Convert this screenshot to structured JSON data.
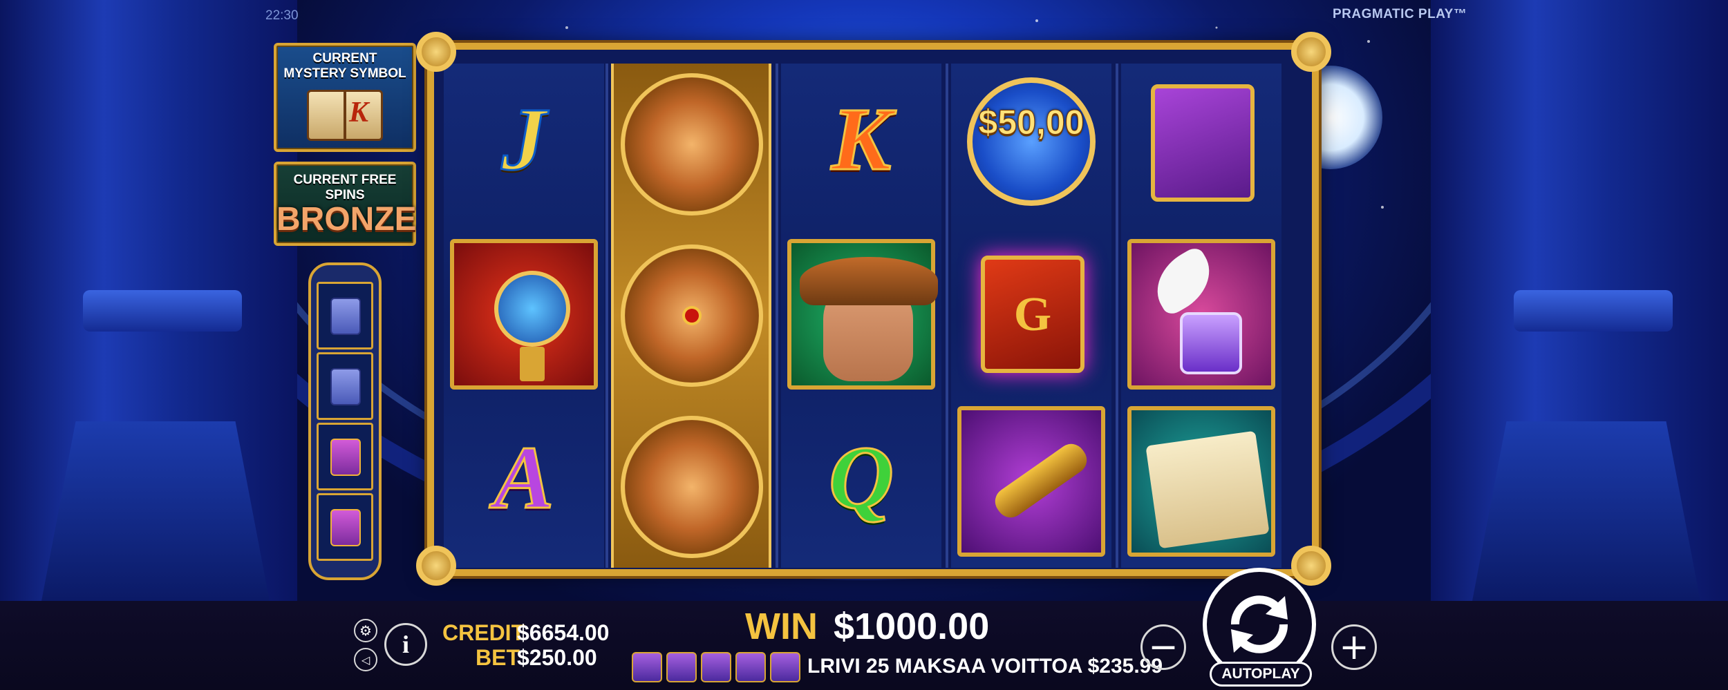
{
  "header": {
    "clock": "22:30",
    "brand": "PRAGMATIC PLAY™"
  },
  "side_panels": {
    "mystery": {
      "title_line1": "CURRENT",
      "title_line2": "MYSTERY SYMBOL",
      "symbol_letter": "K",
      "icon": "book-icon"
    },
    "free_spins": {
      "title": "CURRENT FREE SPINS",
      "level": "BRONZE"
    },
    "progress": {
      "collected": 2,
      "total": 4,
      "icon": "chest-icon"
    }
  },
  "reels": [
    {
      "symbols": [
        "J",
        "armillary-sphere",
        "A"
      ]
    },
    {
      "symbols": [
        "compass",
        "compass-rose",
        "compass"
      ]
    },
    {
      "symbols": [
        "K",
        "explorer",
        "Q"
      ]
    },
    {
      "symbols": [
        "$50,00",
        "book-of-mystery",
        "telescope"
      ]
    },
    {
      "symbols": [
        "treasure-book",
        "quill-and-ink",
        "map-scroll"
      ]
    }
  ],
  "money_symbol": {
    "value": "$50,00"
  },
  "bottom_bar": {
    "credit_label": "CREDIT",
    "credit_value": "$6654.00",
    "bet_label": "BET",
    "bet_value": "$250.00",
    "win_label": "WIN",
    "win_value": "$1000.00",
    "line_win_text": "LRIVI 25 MAKSAA VOITTOA $235.99",
    "line_win_symbol_count": 5,
    "autoplay_label": "AUTOPLAY",
    "minus_label": "−",
    "plus_label": "+",
    "info_label": "i",
    "settings_icon": "⚙",
    "sound_icon": "◁"
  },
  "colors": {
    "gold": "#d9a534",
    "label_yellow": "#f4c340",
    "background_blue": "#1436b8"
  }
}
